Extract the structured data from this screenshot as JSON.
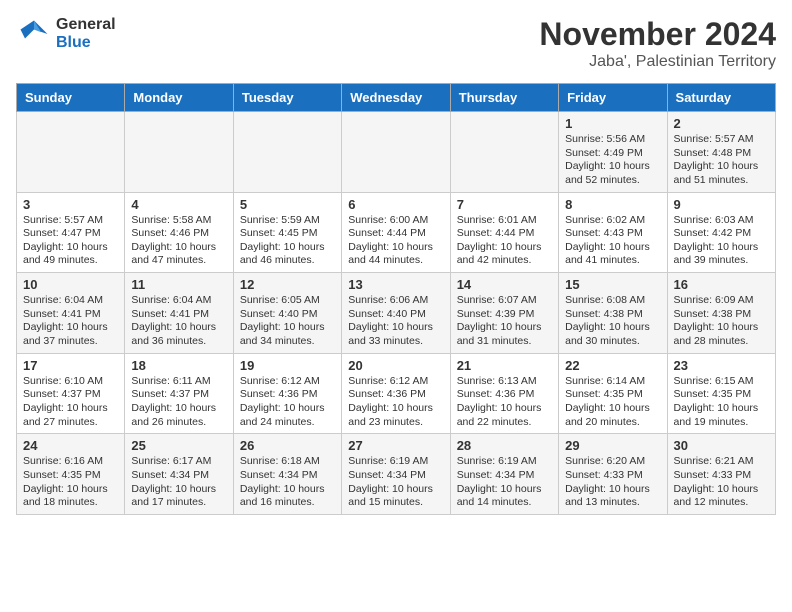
{
  "logo": {
    "line1": "General",
    "line2": "Blue"
  },
  "title": "November 2024",
  "subtitle": "Jaba', Palestinian Territory",
  "days_of_week": [
    "Sunday",
    "Monday",
    "Tuesday",
    "Wednesday",
    "Thursday",
    "Friday",
    "Saturday"
  ],
  "weeks": [
    [
      {
        "day": "",
        "data": ""
      },
      {
        "day": "",
        "data": ""
      },
      {
        "day": "",
        "data": ""
      },
      {
        "day": "",
        "data": ""
      },
      {
        "day": "",
        "data": ""
      },
      {
        "day": "1",
        "data": "Sunrise: 5:56 AM\nSunset: 4:49 PM\nDaylight: 10 hours and 52 minutes."
      },
      {
        "day": "2",
        "data": "Sunrise: 5:57 AM\nSunset: 4:48 PM\nDaylight: 10 hours and 51 minutes."
      }
    ],
    [
      {
        "day": "3",
        "data": "Sunrise: 5:57 AM\nSunset: 4:47 PM\nDaylight: 10 hours and 49 minutes."
      },
      {
        "day": "4",
        "data": "Sunrise: 5:58 AM\nSunset: 4:46 PM\nDaylight: 10 hours and 47 minutes."
      },
      {
        "day": "5",
        "data": "Sunrise: 5:59 AM\nSunset: 4:45 PM\nDaylight: 10 hours and 46 minutes."
      },
      {
        "day": "6",
        "data": "Sunrise: 6:00 AM\nSunset: 4:44 PM\nDaylight: 10 hours and 44 minutes."
      },
      {
        "day": "7",
        "data": "Sunrise: 6:01 AM\nSunset: 4:44 PM\nDaylight: 10 hours and 42 minutes."
      },
      {
        "day": "8",
        "data": "Sunrise: 6:02 AM\nSunset: 4:43 PM\nDaylight: 10 hours and 41 minutes."
      },
      {
        "day": "9",
        "data": "Sunrise: 6:03 AM\nSunset: 4:42 PM\nDaylight: 10 hours and 39 minutes."
      }
    ],
    [
      {
        "day": "10",
        "data": "Sunrise: 6:04 AM\nSunset: 4:41 PM\nDaylight: 10 hours and 37 minutes."
      },
      {
        "day": "11",
        "data": "Sunrise: 6:04 AM\nSunset: 4:41 PM\nDaylight: 10 hours and 36 minutes."
      },
      {
        "day": "12",
        "data": "Sunrise: 6:05 AM\nSunset: 4:40 PM\nDaylight: 10 hours and 34 minutes."
      },
      {
        "day": "13",
        "data": "Sunrise: 6:06 AM\nSunset: 4:40 PM\nDaylight: 10 hours and 33 minutes."
      },
      {
        "day": "14",
        "data": "Sunrise: 6:07 AM\nSunset: 4:39 PM\nDaylight: 10 hours and 31 minutes."
      },
      {
        "day": "15",
        "data": "Sunrise: 6:08 AM\nSunset: 4:38 PM\nDaylight: 10 hours and 30 minutes."
      },
      {
        "day": "16",
        "data": "Sunrise: 6:09 AM\nSunset: 4:38 PM\nDaylight: 10 hours and 28 minutes."
      }
    ],
    [
      {
        "day": "17",
        "data": "Sunrise: 6:10 AM\nSunset: 4:37 PM\nDaylight: 10 hours and 27 minutes."
      },
      {
        "day": "18",
        "data": "Sunrise: 6:11 AM\nSunset: 4:37 PM\nDaylight: 10 hours and 26 minutes."
      },
      {
        "day": "19",
        "data": "Sunrise: 6:12 AM\nSunset: 4:36 PM\nDaylight: 10 hours and 24 minutes."
      },
      {
        "day": "20",
        "data": "Sunrise: 6:12 AM\nSunset: 4:36 PM\nDaylight: 10 hours and 23 minutes."
      },
      {
        "day": "21",
        "data": "Sunrise: 6:13 AM\nSunset: 4:36 PM\nDaylight: 10 hours and 22 minutes."
      },
      {
        "day": "22",
        "data": "Sunrise: 6:14 AM\nSunset: 4:35 PM\nDaylight: 10 hours and 20 minutes."
      },
      {
        "day": "23",
        "data": "Sunrise: 6:15 AM\nSunset: 4:35 PM\nDaylight: 10 hours and 19 minutes."
      }
    ],
    [
      {
        "day": "24",
        "data": "Sunrise: 6:16 AM\nSunset: 4:35 PM\nDaylight: 10 hours and 18 minutes."
      },
      {
        "day": "25",
        "data": "Sunrise: 6:17 AM\nSunset: 4:34 PM\nDaylight: 10 hours and 17 minutes."
      },
      {
        "day": "26",
        "data": "Sunrise: 6:18 AM\nSunset: 4:34 PM\nDaylight: 10 hours and 16 minutes."
      },
      {
        "day": "27",
        "data": "Sunrise: 6:19 AM\nSunset: 4:34 PM\nDaylight: 10 hours and 15 minutes."
      },
      {
        "day": "28",
        "data": "Sunrise: 6:19 AM\nSunset: 4:34 PM\nDaylight: 10 hours and 14 minutes."
      },
      {
        "day": "29",
        "data": "Sunrise: 6:20 AM\nSunset: 4:33 PM\nDaylight: 10 hours and 13 minutes."
      },
      {
        "day": "30",
        "data": "Sunrise: 6:21 AM\nSunset: 4:33 PM\nDaylight: 10 hours and 12 minutes."
      }
    ]
  ]
}
